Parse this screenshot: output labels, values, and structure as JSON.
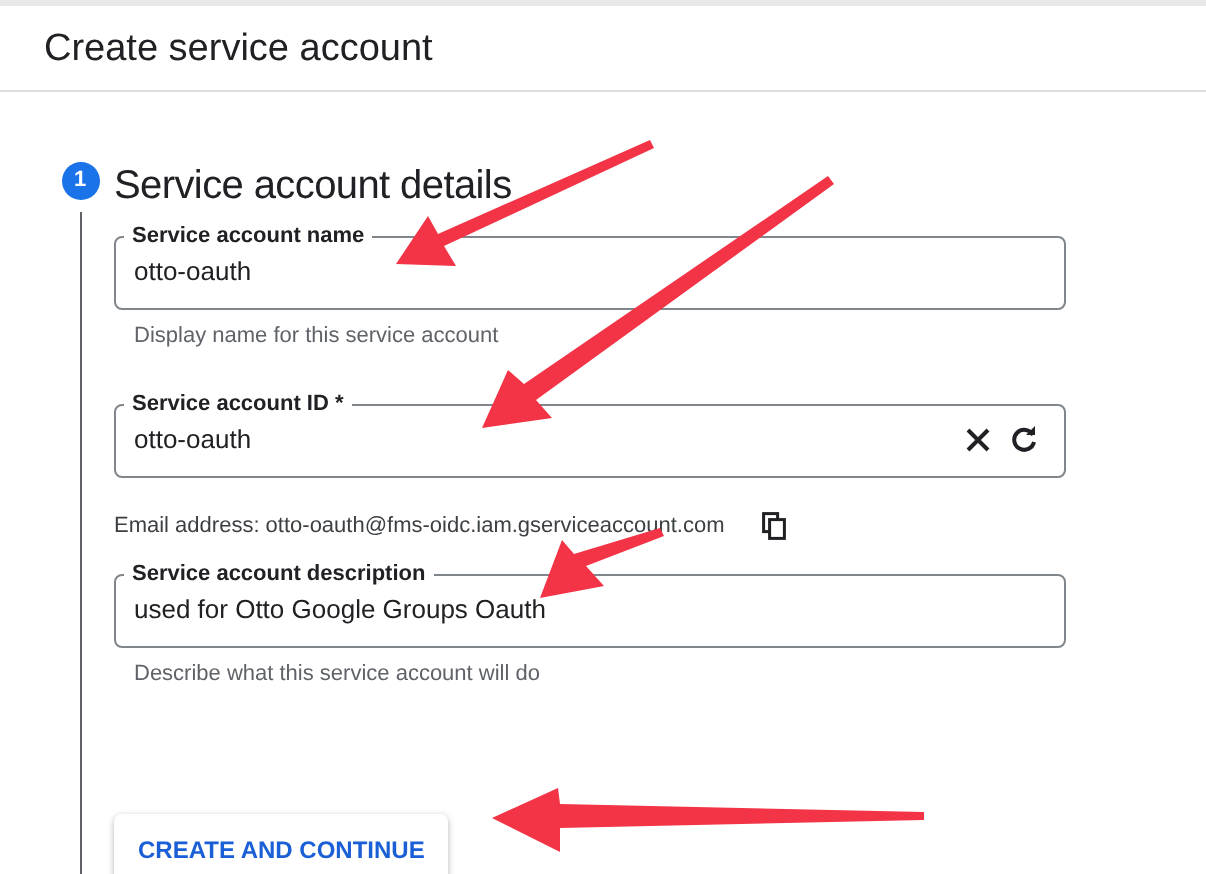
{
  "header": {
    "title": "Create service account"
  },
  "step": {
    "number": "1",
    "title": "Service account details"
  },
  "fields": [
    {
      "kind": "plain",
      "label": "Service account name",
      "value": "otto-oauth",
      "helper": "Display name for this service account"
    },
    {
      "kind": "id",
      "label": "Service account ID *",
      "value": "otto-oauth",
      "note": "Email address: otto-oauth@fms-oidc.iam.gserviceaccount.com"
    },
    {
      "kind": "plain",
      "label": "Service account description",
      "value": "used for Otto Google Groups Oauth",
      "helper": "Describe what this service account will do"
    }
  ],
  "primary_button": "CREATE AND CONTINUE"
}
